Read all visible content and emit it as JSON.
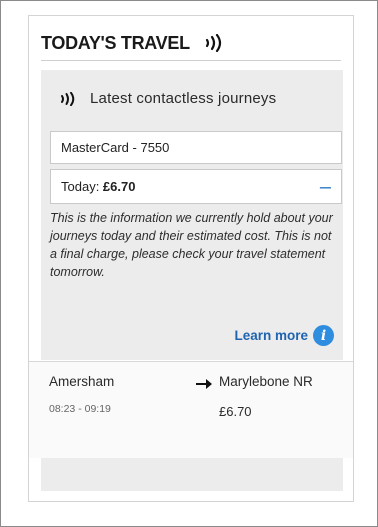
{
  "widget": {
    "title": "TODAY'S TRAVEL",
    "title_icon": "contactless-icon"
  },
  "panel": {
    "heading": "Latest contactless journeys",
    "heading_icon": "contactless-icon",
    "card_label": "MasterCard - 7550",
    "today_prefix": "Today: ",
    "today_amount": "£6.70",
    "collapse_symbol": "–",
    "info_text": "This is the information we currently hold about your journeys today and their estimated cost. This is not a final charge, please check your travel statement tomorrow.",
    "learn_more": "Learn more",
    "info_icon_glyph": "i"
  },
  "journeys": [
    {
      "from": "Amersham",
      "time": "08:23 - 09:19",
      "to": "Marylebone NR",
      "fare": "£6.70"
    }
  ],
  "colors": {
    "accent_blue": "#2f8de0",
    "link_blue": "#1f64b0",
    "panel_grey": "#ececec"
  }
}
